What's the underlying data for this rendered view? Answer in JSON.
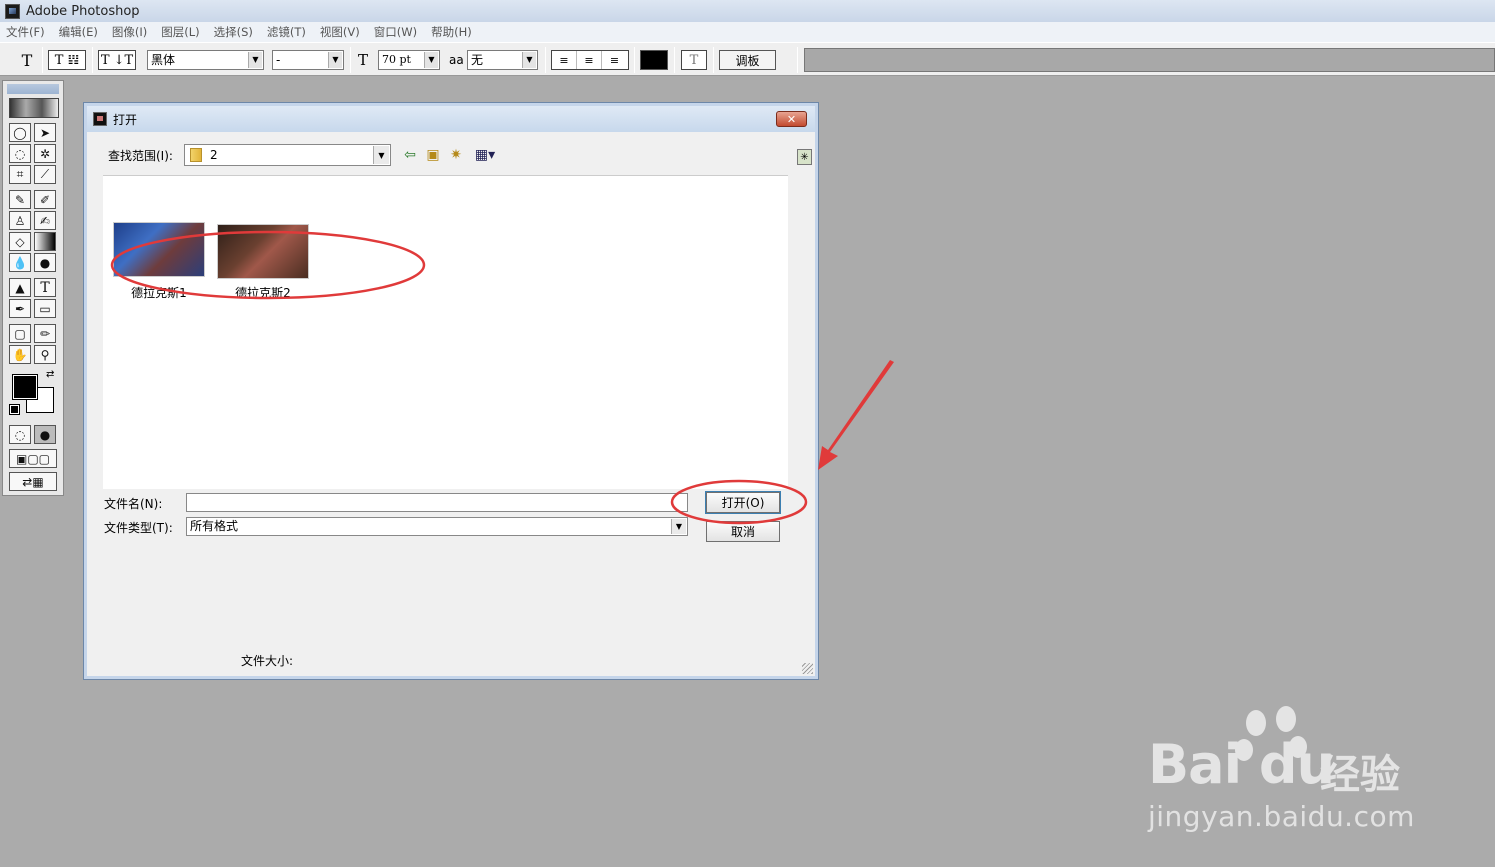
{
  "app": {
    "title": "Adobe Photoshop"
  },
  "menu": [
    "文件(F)",
    "编辑(E)",
    "图像(I)",
    "图层(L)",
    "选择(S)",
    "滤镜(T)",
    "视图(V)",
    "窗口(W)",
    "帮助(H)"
  ],
  "options_bar": {
    "type_tool": "T",
    "mode_btn_1": "T 𝍒",
    "orient_btn": "T ↓T",
    "font_family": "黑体",
    "font_style": "-",
    "size_icon": "T",
    "font_size": "70 pt",
    "aa_icon": "aa",
    "anti_alias": "无",
    "warp_icon": "T",
    "palettes_label": "调板",
    "text_color": "#000000"
  },
  "dialog": {
    "title": "打开",
    "close": "✕",
    "look_in_label": "查找范围(I):",
    "look_in_value": "2",
    "files": [
      {
        "name": "德拉克斯1"
      },
      {
        "name": "德拉克斯2"
      }
    ],
    "filename_label": "文件名(N):",
    "filename_value": "",
    "filetype_label": "文件类型(T):",
    "filetype_value": "所有格式",
    "open_button": "打开(O)",
    "cancel_button": "取消",
    "file_size_label": "文件大小:"
  },
  "annotation_color": "#e03a3a",
  "watermark": {
    "brand": "Bai du",
    "cn": "经验",
    "url": "jingyan.baidu.com"
  }
}
